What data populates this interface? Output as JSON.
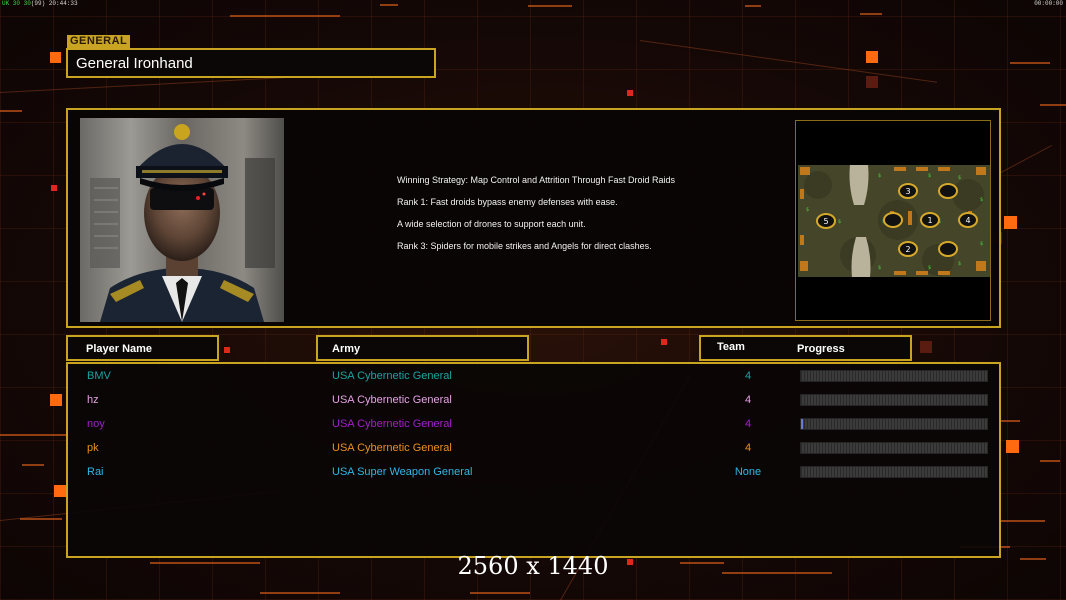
{
  "topbar": {
    "fps_text": "UK 30 30",
    "frame_count": "(99)",
    "session_time": "20:44:33",
    "clock": "00:00:00"
  },
  "general": {
    "tag": "GENERAL",
    "name": "General Ironhand"
  },
  "strategy": {
    "lines": [
      "Winning Strategy: Map Control and Attrition Through Fast Droid Raids",
      "Rank 1: Fast droids bypass enemy defenses with ease.",
      "A wide selection of drones to support each unit.",
      "Rank 3: Spiders for mobile strikes and Angels for direct clashes."
    ]
  },
  "map": {
    "player_slots": [
      "3",
      "5",
      "1",
      "4",
      "2"
    ]
  },
  "table": {
    "headers": {
      "player_name": "Player Name",
      "army": "Army",
      "team": "Team",
      "progress": "Progress"
    },
    "rows": [
      {
        "name": "BMV",
        "army": "USA Cybernetic General",
        "team": "4",
        "color": "#1aa3a3",
        "progress": 0
      },
      {
        "name": "hz",
        "army": "USA Cybernetic General",
        "team": "4",
        "color": "#e6a0e6",
        "progress": 0
      },
      {
        "name": "noy",
        "army": "USA Cybernetic General",
        "team": "4",
        "color": "#a020c8",
        "progress": 0.01
      },
      {
        "name": "pk",
        "army": "USA Cybernetic General",
        "team": "4",
        "color": "#e89020",
        "progress": 0
      },
      {
        "name": "Rai",
        "army": "USA Super Weapon General",
        "team": "None",
        "color": "#2eb8e6",
        "progress": 0
      }
    ]
  },
  "resolution_text": "2560 x 1440",
  "colors": {
    "accent_gold": "#c9a421",
    "accent_orange": "#ff6a10",
    "background": "#120806"
  }
}
